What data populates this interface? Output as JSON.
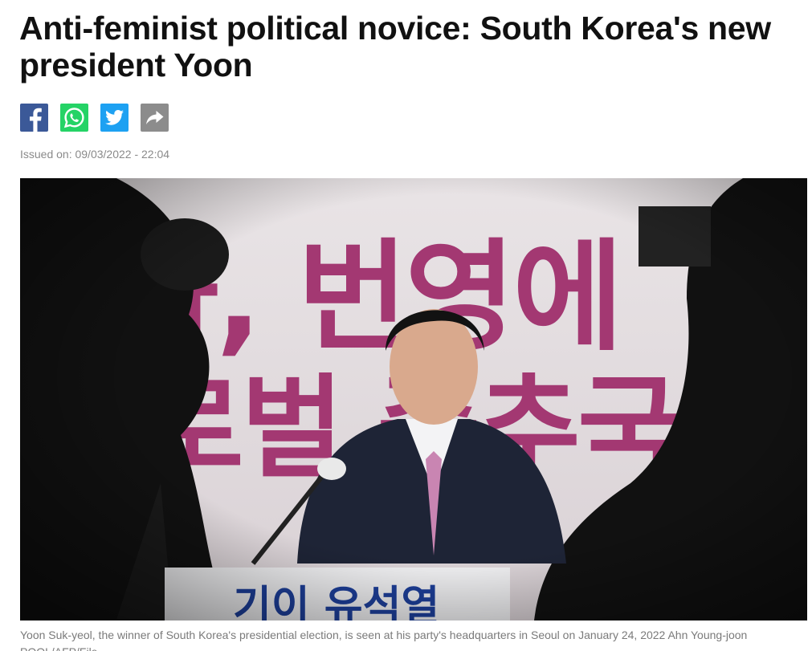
{
  "article": {
    "headline": "Anti-feminist political novice: South Korea's new president Yoon",
    "issued": "Issued on: 09/03/2022 - 22:04",
    "photo_alt": "Yoon Suk-yeol speaking at a podium",
    "caption": "Yoon Suk-yeol, the winner of South Korea's presidential election, is seen at his party's headquarters in Seoul on January 24, 2022 Ahn Young-joon POOL/AFP/File",
    "banner_text_top": "화, 번영에",
    "banner_text_mid": "로벌 중추국",
    "banner_text_podium": "기이 유석열"
  },
  "share": {
    "buttons": [
      {
        "name": "facebook",
        "icon": "facebook-icon",
        "color": "#3b5998"
      },
      {
        "name": "whatsapp",
        "icon": "whatsapp-icon",
        "color": "#25d366"
      },
      {
        "name": "twitter",
        "icon": "twitter-icon",
        "color": "#1da1f2"
      },
      {
        "name": "share",
        "icon": "share-arrow-icon",
        "color": "#8c8c8c"
      }
    ]
  }
}
